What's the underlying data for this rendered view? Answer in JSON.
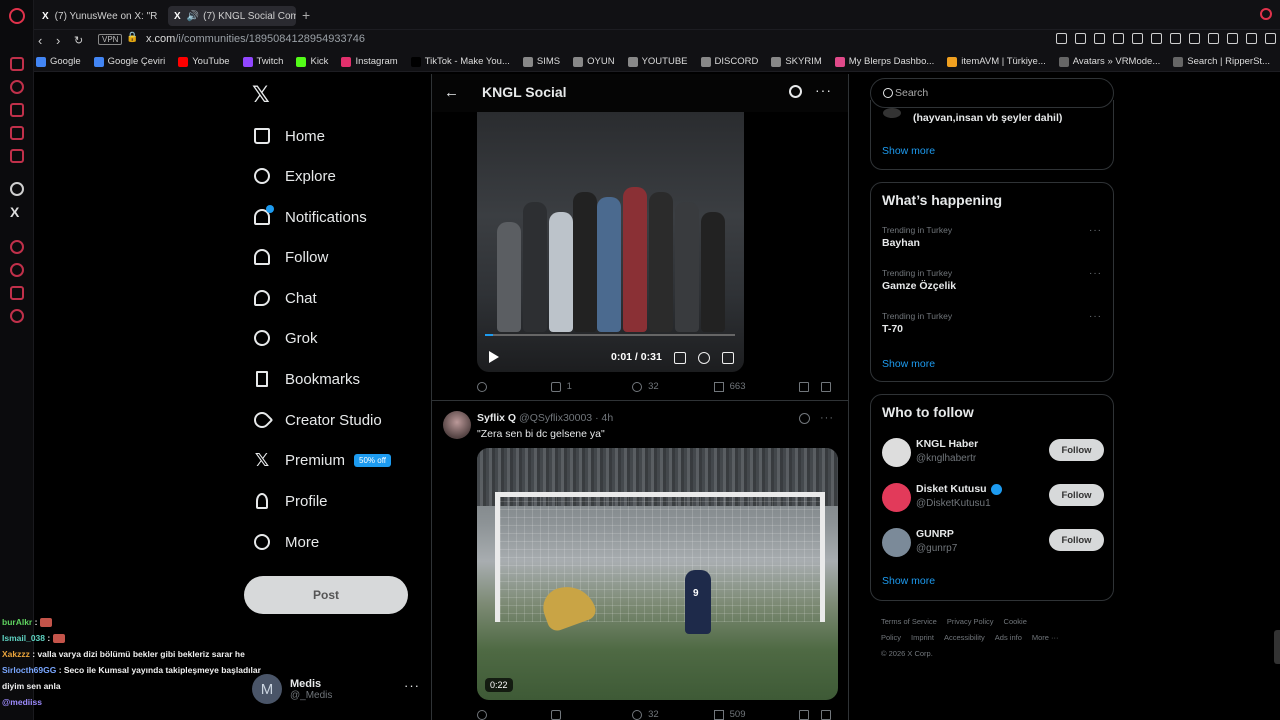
{
  "browser": {
    "tabs": [
      {
        "label": "(7) YunusWee on X: \"R",
        "favicon": "x-icon",
        "active": false
      },
      {
        "label": "(7) KNGL Social Comm",
        "favicon": "x-icon",
        "active": true
      }
    ],
    "url_host": "x.com",
    "url_path": "/i/communities/1895084128954933746",
    "vpn_label": "VPN",
    "bookmarks": [
      {
        "label": "Google",
        "color": "#4285f4"
      },
      {
        "label": "Google Çeviri",
        "color": "#4285f4"
      },
      {
        "label": "YouTube",
        "color": "#ff0000"
      },
      {
        "label": "Twitch",
        "color": "#9146ff"
      },
      {
        "label": "Kick",
        "color": "#53fc18"
      },
      {
        "label": "Instagram",
        "color": "#e1306c"
      },
      {
        "label": "TikTok - Make You...",
        "color": "#000000"
      },
      {
        "label": "SIMS",
        "color": "#888888"
      },
      {
        "label": "OYUN",
        "color": "#888888"
      },
      {
        "label": "YOUTUBE",
        "color": "#888888"
      },
      {
        "label": "DISCORD",
        "color": "#888888"
      },
      {
        "label": "SKYRIM",
        "color": "#888888"
      },
      {
        "label": "My Blerps Dashbo...",
        "color": "#e14a8a"
      },
      {
        "label": "itemAVM | Türkiye...",
        "color": "#f0a020"
      },
      {
        "label": "Avatars » VRMode...",
        "color": "#666666"
      },
      {
        "label": "Search | RipperSt...",
        "color": "#666666"
      }
    ]
  },
  "nav": {
    "items": [
      {
        "label": "Home",
        "icon": "home-icon"
      },
      {
        "label": "Explore",
        "icon": "search-icon"
      },
      {
        "label": "Notifications",
        "icon": "bell-icon"
      },
      {
        "label": "Follow",
        "icon": "person-plus-icon"
      },
      {
        "label": "Chat",
        "icon": "chat-icon"
      },
      {
        "label": "Grok",
        "icon": "grok-icon"
      },
      {
        "label": "Bookmarks",
        "icon": "bookmark-icon"
      },
      {
        "label": "Creator Studio",
        "icon": "rocket-icon"
      },
      {
        "label": "Premium",
        "icon": "x-icon"
      },
      {
        "label": "Profile",
        "icon": "person-icon"
      },
      {
        "label": "More",
        "icon": "more-circle-icon"
      }
    ],
    "premium_badge": "50% off",
    "post_label": "Post",
    "account": {
      "name": "Medis",
      "handle": "@_Medis",
      "initial": "M"
    }
  },
  "chat_overlay": [
    {
      "user": "burAlkr",
      "color": "#5fd35f",
      "text": ""
    },
    {
      "user": "Ismail_038",
      "color": "#5fd3c2",
      "text": ""
    },
    {
      "user": "Xakzzz",
      "color": "#e8a33c",
      "text": "valla varya dizi bölümü bekler gibi bekleriz sarar he"
    },
    {
      "user": "Sirlocth69GG",
      "color": "#7aa7ff",
      "text": "Seco ile Kumsal yayında takipleşmeye başladılar diyim sen anla"
    },
    {
      "user": "@mediiss",
      "color": "#9e8cff",
      "text": ""
    }
  ],
  "main": {
    "title": "KNGL Social",
    "tweet1": {
      "video_time": "0:01 / 0:31",
      "replies": "",
      "reposts": "1",
      "likes": "32",
      "views": "663",
      "progress": 0.03
    },
    "tweet2": {
      "name": "Syflix Q",
      "handle": "@QSyflix30003",
      "time": "4h",
      "text": "\"Zera sen bi dc gelsene ya\"",
      "duration": "0:22",
      "player_number": "9",
      "likes": "32",
      "views": "509"
    }
  },
  "sidebar": {
    "search_placeholder": "Search",
    "community_rule_text": "(hayvan,insan vb şeyler dahil)",
    "show_more": "Show more",
    "happening_title": "What’s happening",
    "trends": [
      {
        "label": "Trending in Turkey",
        "name": "Bayhan"
      },
      {
        "label": "Trending in Turkey",
        "name": "Gamze Özçelik"
      },
      {
        "label": "Trending in Turkey",
        "name": "T-70"
      }
    ],
    "who_to_follow_title": "Who to follow",
    "follow_suggestions": [
      {
        "name": "KNGL Haber",
        "handle": "@knglhabertr",
        "verified": false,
        "button": "Follow",
        "avatar_color": "#dddddd"
      },
      {
        "name": "Disket Kutusu",
        "handle": "@DisketKutusu1",
        "verified": true,
        "button": "Follow",
        "avatar_color": "#e23a5a"
      },
      {
        "name": "GUNRP",
        "handle": "@gunrp7",
        "verified": false,
        "button": "Follow",
        "avatar_color": "#7b8a99"
      }
    ],
    "footer_links": [
      "Terms of Service",
      "Privacy Policy",
      "Cookie Policy",
      "Imprint",
      "Accessibility",
      "Ads info",
      "More ···"
    ],
    "copyright": "© 2026 X Corp."
  }
}
